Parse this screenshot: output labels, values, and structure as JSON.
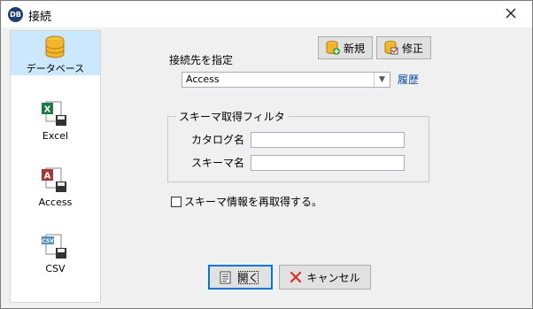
{
  "window": {
    "title": "接続",
    "app_icon": "DB"
  },
  "sidebar": {
    "items": [
      {
        "label": "データベース",
        "icon": "database-icon",
        "selected": true
      },
      {
        "label": "Excel",
        "icon": "excel-icon",
        "selected": false
      },
      {
        "label": "Access",
        "icon": "access-icon",
        "selected": false
      },
      {
        "label": "CSV",
        "icon": "csv-icon",
        "selected": false
      }
    ]
  },
  "connection": {
    "label": "接続先を指定",
    "new_button": "新規",
    "edit_button": "修正",
    "selected_value": "Access",
    "history_link": "履歴"
  },
  "schema_filter": {
    "legend": "スキーマ取得フィルタ",
    "catalog_label": "カタログ名",
    "catalog_value": "",
    "schema_label": "スキーマ名",
    "schema_value": ""
  },
  "refetch": {
    "label": "スキーマ情報を再取得する。",
    "checked": false
  },
  "footer": {
    "open_button": "開く",
    "cancel_button": "キャンセル"
  },
  "colors": {
    "selected_bg": "#cce8ff",
    "link": "#0c4da2",
    "focus": "#0078d7"
  }
}
